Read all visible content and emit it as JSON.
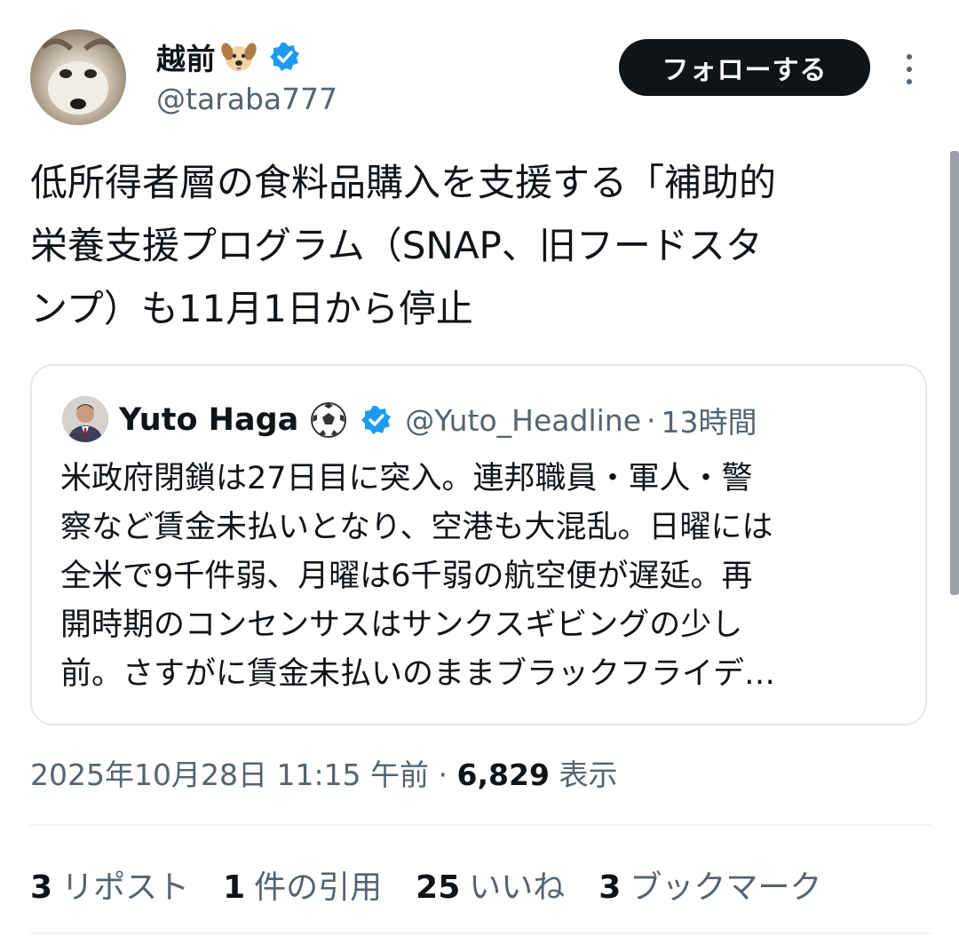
{
  "author": {
    "display_name": "越前",
    "emoji": "dog-face-emoji",
    "verified": true,
    "handle": "@taraba777"
  },
  "follow_button_label": "フォローする",
  "tweet_text": "低所得者層の食料品購入を支援する「補助的\n栄養支援プログラム（SNAP、旧フードスタ\nンプ）も11月1日から停止",
  "quoted_tweet": {
    "display_name": "Yuto Haga",
    "emoji": "soccer-ball-emoji",
    "verified": true,
    "handle": "@Yuto_Headline",
    "separator": "·",
    "time": "13時間",
    "text": "米政府閉鎖は27日目に突入。連邦職員・軍人・警\n察など賃金未払いとなり、空港も大混乱。日曜には\n全米で9千件弱、月曜は6千弱の航空便が遅延。再\n開時期のコンセンサスはサンクスギビングの少し\n前。さすがに賃金未払いのままブラックフライデ…"
  },
  "meta": {
    "timestamp": "2025年10月28日 11:15 午前",
    "separator": "·",
    "views_count": "6,829",
    "views_label": "表示"
  },
  "stats": [
    {
      "count": "3",
      "label": "リポスト"
    },
    {
      "count": "1",
      "label": "件の引用"
    },
    {
      "count": "25",
      "label": "いいね"
    },
    {
      "count": "3",
      "label": "ブックマーク"
    }
  ],
  "colors": {
    "text": "#0f1419",
    "secondary": "#536471",
    "verified": "#1d9bf0",
    "button_bg": "#0f1419",
    "border": "#e4e8eb"
  }
}
